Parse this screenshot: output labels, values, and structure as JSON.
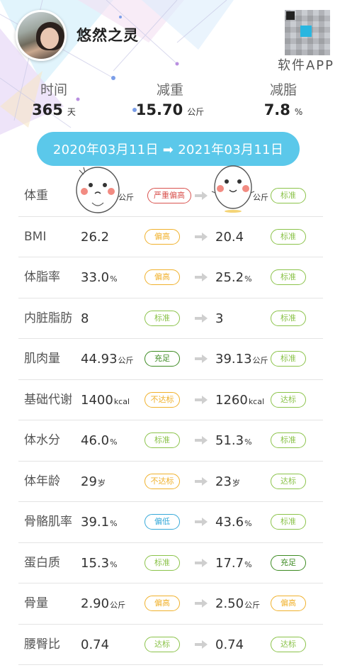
{
  "profile": {
    "username": "悠然之灵",
    "app_label": "软件APP"
  },
  "stats": [
    {
      "label": "时间",
      "value": "365",
      "unit": "天"
    },
    {
      "label": "减重",
      "value": "15.70",
      "unit": "公斤"
    },
    {
      "label": "减脂",
      "value": "7.8",
      "unit": "%"
    }
  ],
  "date_range": "2020年03月11日 ➡ 2021年03月11日",
  "colors": {
    "accent": "#5bc8ea",
    "standard": "#8bc34a",
    "high": "#f0b12c",
    "severe": "#d9534f",
    "low": "#36a9d9",
    "sufficient": "#3d8b22"
  },
  "metrics": [
    {
      "name": "体重",
      "before": "",
      "before_unit": "公斤",
      "before_badge": "严重偏高",
      "before_color": "#d9534f",
      "after": "",
      "after_unit": "公斤",
      "after_badge": "标准",
      "after_color": "#8bc34a"
    },
    {
      "name": "BMI",
      "before": "26.2",
      "before_unit": "",
      "before_badge": "偏高",
      "before_color": "#f0b12c",
      "after": "20.4",
      "after_unit": "",
      "after_badge": "标准",
      "after_color": "#8bc34a"
    },
    {
      "name": "体脂率",
      "before": "33.0",
      "before_unit": "%",
      "before_badge": "偏高",
      "before_color": "#f0b12c",
      "after": "25.2",
      "after_unit": "%",
      "after_badge": "标准",
      "after_color": "#8bc34a"
    },
    {
      "name": "内脏脂肪",
      "before": "8",
      "before_unit": "",
      "before_badge": "标准",
      "before_color": "#8bc34a",
      "after": "3",
      "after_unit": "",
      "after_badge": "标准",
      "after_color": "#8bc34a"
    },
    {
      "name": "肌肉量",
      "before": "44.93",
      "before_unit": "公斤",
      "before_badge": "充足",
      "before_color": "#3d8b22",
      "after": "39.13",
      "after_unit": "公斤",
      "after_badge": "标准",
      "after_color": "#8bc34a"
    },
    {
      "name": "基础代谢",
      "before": "1400",
      "before_unit": "kcal",
      "before_badge": "不达标",
      "before_color": "#f0b12c",
      "after": "1260",
      "after_unit": "kcal",
      "after_badge": "达标",
      "after_color": "#8bc34a"
    },
    {
      "name": "体水分",
      "before": "46.0",
      "before_unit": "%",
      "before_badge": "标准",
      "before_color": "#8bc34a",
      "after": "51.3",
      "after_unit": "%",
      "after_badge": "标准",
      "after_color": "#8bc34a"
    },
    {
      "name": "体年龄",
      "before": "29",
      "before_unit": "岁",
      "before_badge": "不达标",
      "before_color": "#f0b12c",
      "after": "23",
      "after_unit": "岁",
      "after_badge": "达标",
      "after_color": "#8bc34a"
    },
    {
      "name": "骨骼肌率",
      "before": "39.1",
      "before_unit": "%",
      "before_badge": "偏低",
      "before_color": "#36a9d9",
      "after": "43.6",
      "after_unit": "%",
      "after_badge": "标准",
      "after_color": "#8bc34a"
    },
    {
      "name": "蛋白质",
      "before": "15.3",
      "before_unit": "%",
      "before_badge": "标准",
      "before_color": "#8bc34a",
      "after": "17.7",
      "after_unit": "%",
      "after_badge": "充足",
      "after_color": "#3d8b22"
    },
    {
      "name": "骨量",
      "before": "2.90",
      "before_unit": "公斤",
      "before_badge": "偏高",
      "before_color": "#f0b12c",
      "after": "2.50",
      "after_unit": "公斤",
      "after_badge": "偏高",
      "after_color": "#f0b12c"
    },
    {
      "name": "腰臀比",
      "before": "0.74",
      "before_unit": "",
      "before_badge": "达标",
      "before_color": "#8bc34a",
      "after": "0.74",
      "after_unit": "",
      "after_badge": "达标",
      "after_color": "#8bc34a"
    }
  ]
}
